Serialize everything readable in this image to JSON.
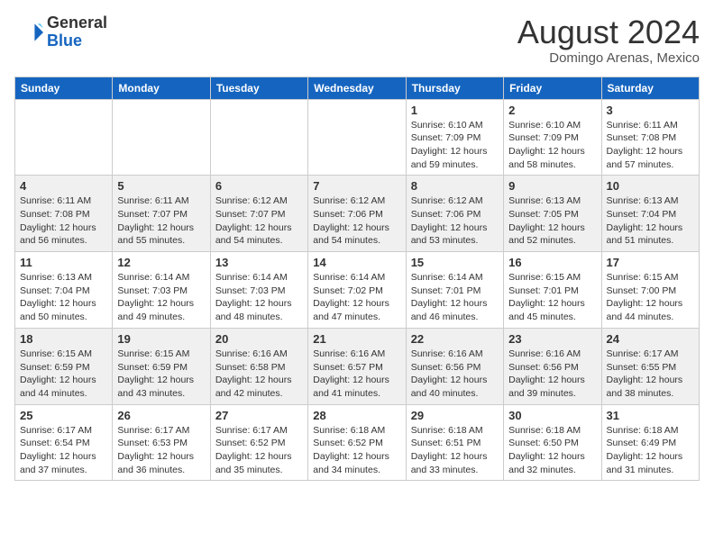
{
  "header": {
    "logo_line1": "General",
    "logo_line2": "Blue",
    "month": "August 2024",
    "location": "Domingo Arenas, Mexico"
  },
  "weekdays": [
    "Sunday",
    "Monday",
    "Tuesday",
    "Wednesday",
    "Thursday",
    "Friday",
    "Saturday"
  ],
  "weeks": [
    [
      {
        "day": "",
        "info": ""
      },
      {
        "day": "",
        "info": ""
      },
      {
        "day": "",
        "info": ""
      },
      {
        "day": "",
        "info": ""
      },
      {
        "day": "1",
        "info": "Sunrise: 6:10 AM\nSunset: 7:09 PM\nDaylight: 12 hours\nand 59 minutes."
      },
      {
        "day": "2",
        "info": "Sunrise: 6:10 AM\nSunset: 7:09 PM\nDaylight: 12 hours\nand 58 minutes."
      },
      {
        "day": "3",
        "info": "Sunrise: 6:11 AM\nSunset: 7:08 PM\nDaylight: 12 hours\nand 57 minutes."
      }
    ],
    [
      {
        "day": "4",
        "info": "Sunrise: 6:11 AM\nSunset: 7:08 PM\nDaylight: 12 hours\nand 56 minutes."
      },
      {
        "day": "5",
        "info": "Sunrise: 6:11 AM\nSunset: 7:07 PM\nDaylight: 12 hours\nand 55 minutes."
      },
      {
        "day": "6",
        "info": "Sunrise: 6:12 AM\nSunset: 7:07 PM\nDaylight: 12 hours\nand 54 minutes."
      },
      {
        "day": "7",
        "info": "Sunrise: 6:12 AM\nSunset: 7:06 PM\nDaylight: 12 hours\nand 54 minutes."
      },
      {
        "day": "8",
        "info": "Sunrise: 6:12 AM\nSunset: 7:06 PM\nDaylight: 12 hours\nand 53 minutes."
      },
      {
        "day": "9",
        "info": "Sunrise: 6:13 AM\nSunset: 7:05 PM\nDaylight: 12 hours\nand 52 minutes."
      },
      {
        "day": "10",
        "info": "Sunrise: 6:13 AM\nSunset: 7:04 PM\nDaylight: 12 hours\nand 51 minutes."
      }
    ],
    [
      {
        "day": "11",
        "info": "Sunrise: 6:13 AM\nSunset: 7:04 PM\nDaylight: 12 hours\nand 50 minutes."
      },
      {
        "day": "12",
        "info": "Sunrise: 6:14 AM\nSunset: 7:03 PM\nDaylight: 12 hours\nand 49 minutes."
      },
      {
        "day": "13",
        "info": "Sunrise: 6:14 AM\nSunset: 7:03 PM\nDaylight: 12 hours\nand 48 minutes."
      },
      {
        "day": "14",
        "info": "Sunrise: 6:14 AM\nSunset: 7:02 PM\nDaylight: 12 hours\nand 47 minutes."
      },
      {
        "day": "15",
        "info": "Sunrise: 6:14 AM\nSunset: 7:01 PM\nDaylight: 12 hours\nand 46 minutes."
      },
      {
        "day": "16",
        "info": "Sunrise: 6:15 AM\nSunset: 7:01 PM\nDaylight: 12 hours\nand 45 minutes."
      },
      {
        "day": "17",
        "info": "Sunrise: 6:15 AM\nSunset: 7:00 PM\nDaylight: 12 hours\nand 44 minutes."
      }
    ],
    [
      {
        "day": "18",
        "info": "Sunrise: 6:15 AM\nSunset: 6:59 PM\nDaylight: 12 hours\nand 44 minutes."
      },
      {
        "day": "19",
        "info": "Sunrise: 6:15 AM\nSunset: 6:59 PM\nDaylight: 12 hours\nand 43 minutes."
      },
      {
        "day": "20",
        "info": "Sunrise: 6:16 AM\nSunset: 6:58 PM\nDaylight: 12 hours\nand 42 minutes."
      },
      {
        "day": "21",
        "info": "Sunrise: 6:16 AM\nSunset: 6:57 PM\nDaylight: 12 hours\nand 41 minutes."
      },
      {
        "day": "22",
        "info": "Sunrise: 6:16 AM\nSunset: 6:56 PM\nDaylight: 12 hours\nand 40 minutes."
      },
      {
        "day": "23",
        "info": "Sunrise: 6:16 AM\nSunset: 6:56 PM\nDaylight: 12 hours\nand 39 minutes."
      },
      {
        "day": "24",
        "info": "Sunrise: 6:17 AM\nSunset: 6:55 PM\nDaylight: 12 hours\nand 38 minutes."
      }
    ],
    [
      {
        "day": "25",
        "info": "Sunrise: 6:17 AM\nSunset: 6:54 PM\nDaylight: 12 hours\nand 37 minutes."
      },
      {
        "day": "26",
        "info": "Sunrise: 6:17 AM\nSunset: 6:53 PM\nDaylight: 12 hours\nand 36 minutes."
      },
      {
        "day": "27",
        "info": "Sunrise: 6:17 AM\nSunset: 6:52 PM\nDaylight: 12 hours\nand 35 minutes."
      },
      {
        "day": "28",
        "info": "Sunrise: 6:18 AM\nSunset: 6:52 PM\nDaylight: 12 hours\nand 34 minutes."
      },
      {
        "day": "29",
        "info": "Sunrise: 6:18 AM\nSunset: 6:51 PM\nDaylight: 12 hours\nand 33 minutes."
      },
      {
        "day": "30",
        "info": "Sunrise: 6:18 AM\nSunset: 6:50 PM\nDaylight: 12 hours\nand 32 minutes."
      },
      {
        "day": "31",
        "info": "Sunrise: 6:18 AM\nSunset: 6:49 PM\nDaylight: 12 hours\nand 31 minutes."
      }
    ]
  ]
}
